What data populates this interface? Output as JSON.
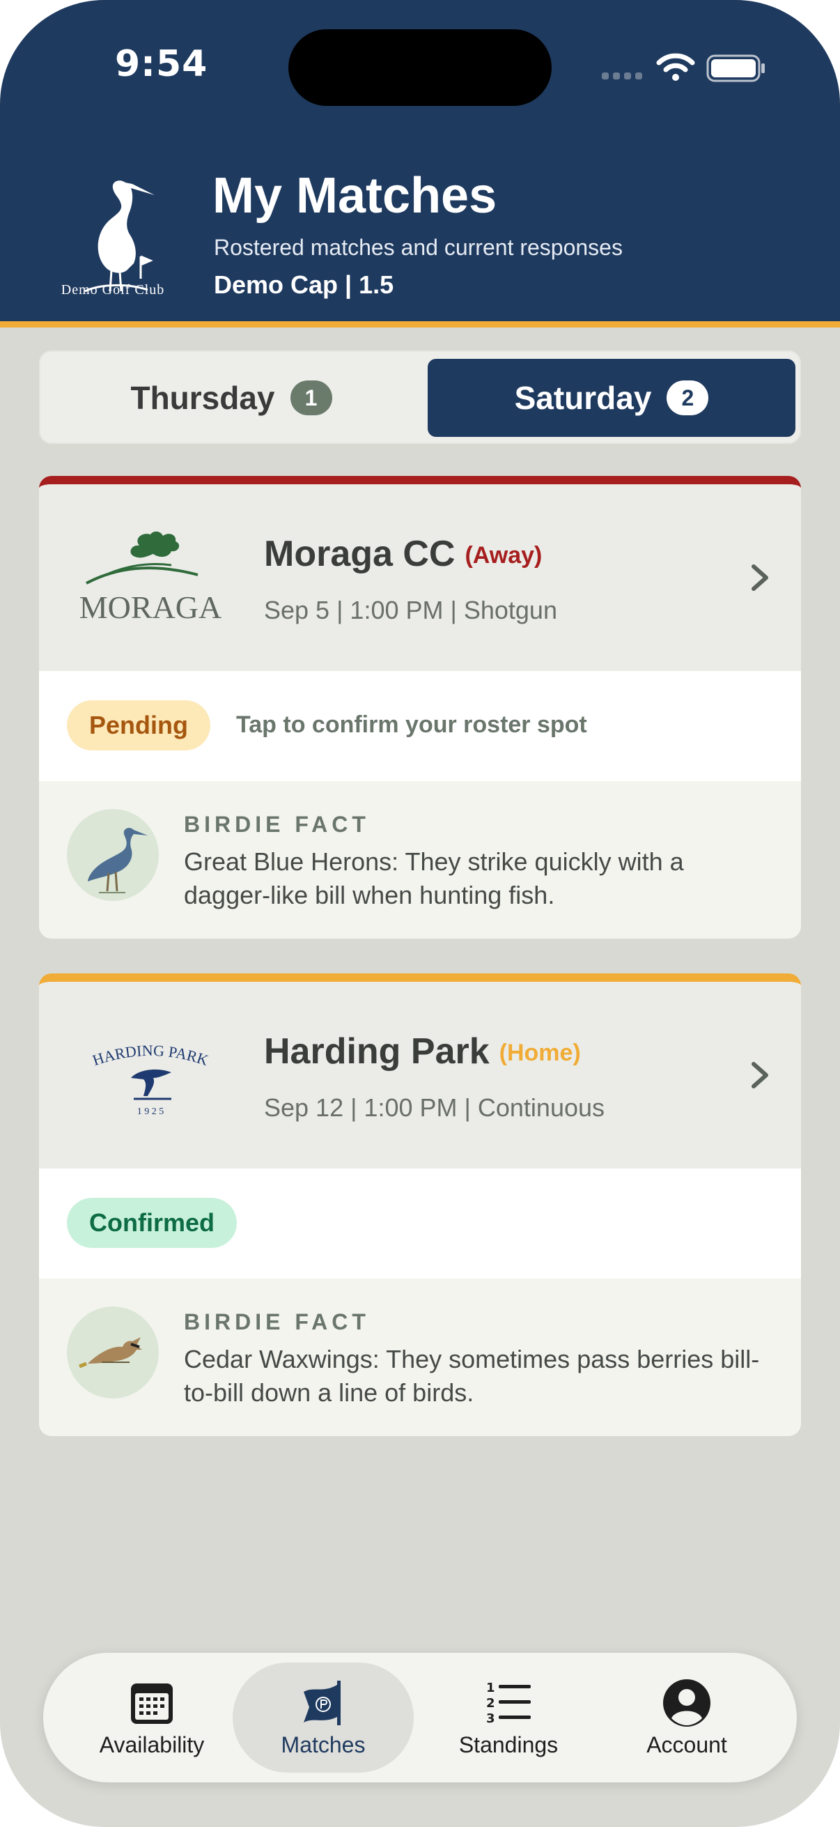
{
  "status_bar": {
    "time": "9:54"
  },
  "header": {
    "logo_caption": "Demo Golf Club",
    "title": "My Matches",
    "subtitle": "Rostered matches and current responses",
    "user_line": "Demo Cap | 1.5"
  },
  "tabs": [
    {
      "label": "Thursday",
      "count": "1",
      "selected": false
    },
    {
      "label": "Saturday",
      "count": "2",
      "selected": true
    }
  ],
  "matches": [
    {
      "course": "Moraga CC",
      "venue": "(Away)",
      "meta": "Sep 5 | 1:00 PM | Shotgun",
      "status": "Pending",
      "status_hint": "Tap to confirm your roster spot",
      "fact_label": "BIRDIE FACT",
      "fact_text": "Great Blue Herons: They strike quickly with a dagger-like bill when hunting fish.",
      "logo_text": "MORAGA",
      "bird": "great-blue-heron"
    },
    {
      "course": "Harding Park",
      "venue": "(Home)",
      "meta": "Sep 12 | 1:00 PM | Continuous",
      "status": "Confirmed",
      "fact_label": "BIRDIE FACT",
      "fact_text": "Cedar Waxwings: They sometimes pass berries bill-to-bill down a line of birds.",
      "logo_text": "HARDING PARK",
      "logo_year": "1 9 2 5",
      "bird": "cedar-waxwing"
    }
  ],
  "nav": [
    {
      "label": "Availability",
      "icon": "calendar-icon",
      "active": false
    },
    {
      "label": "Matches",
      "icon": "flag-icon",
      "active": true
    },
    {
      "label": "Standings",
      "icon": "ordered-list-icon",
      "active": false
    },
    {
      "label": "Account",
      "icon": "account-icon",
      "active": false
    }
  ],
  "colors": {
    "navy": "#1f3a5f",
    "gold": "#f0ac36",
    "away_red": "#a61e1e",
    "pending_bg": "#fde9b8",
    "confirmed_bg": "#c8f1dc"
  }
}
